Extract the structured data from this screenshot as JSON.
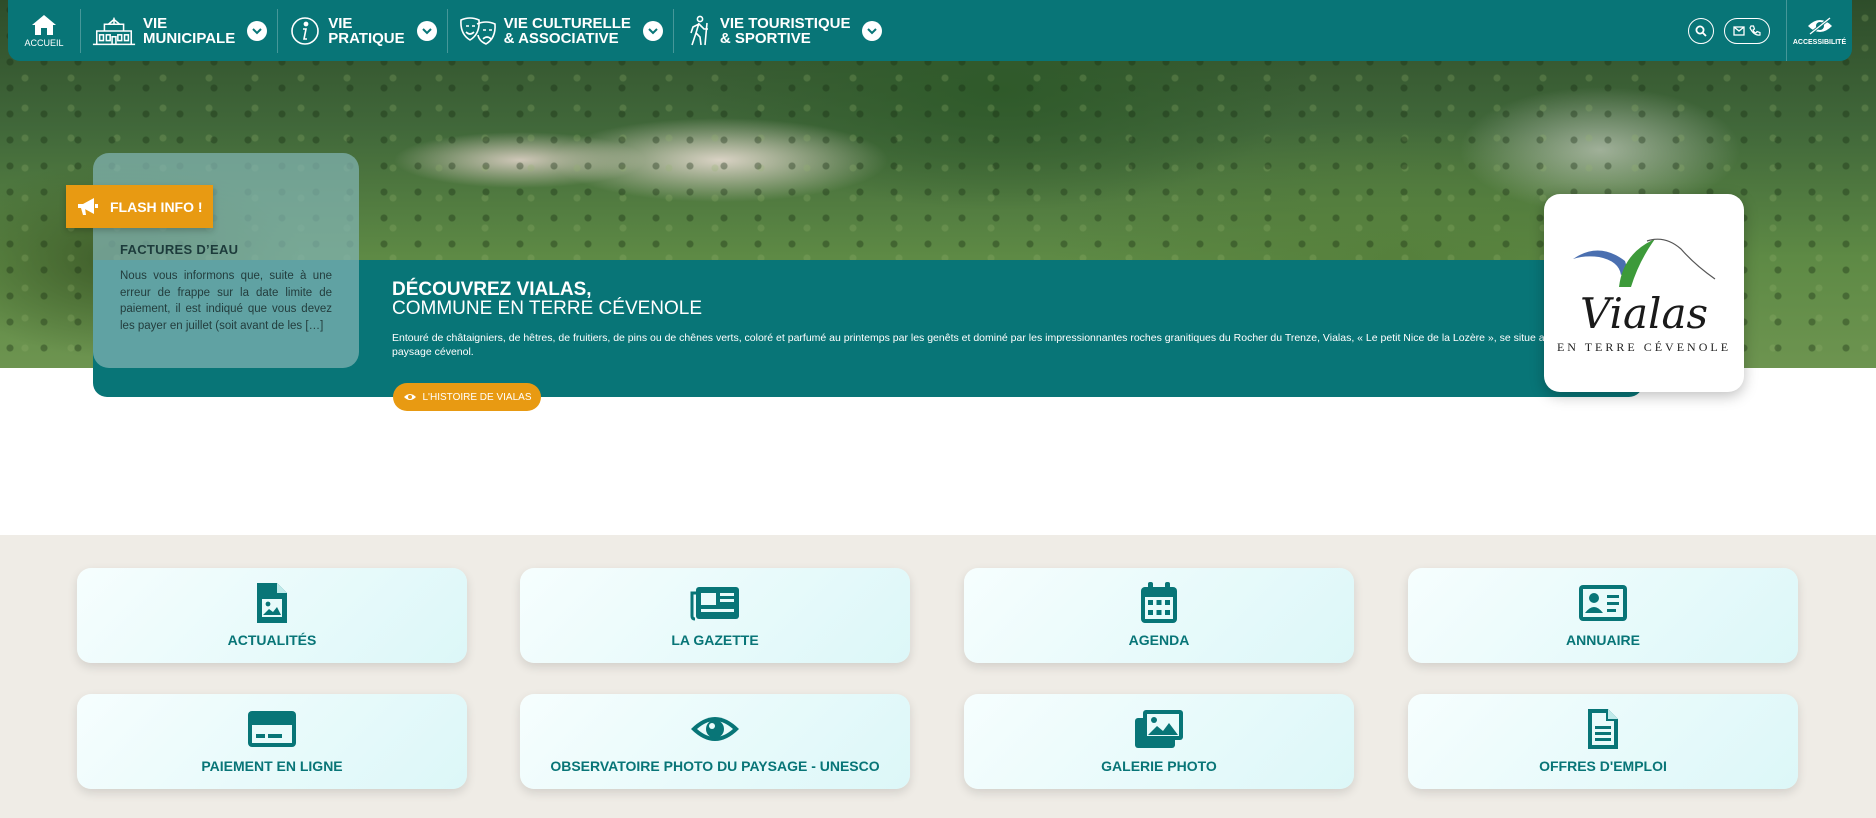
{
  "colors": {
    "primary": "#087577",
    "accent": "#e89a12",
    "quick_bg": "#efece6"
  },
  "nav": {
    "home_label": "ACCUEIL",
    "items": [
      {
        "label": "VIE\nMUNICIPALE",
        "icon": "town-hall-icon"
      },
      {
        "label": "VIE\nPRATIQUE",
        "icon": "info-icon"
      },
      {
        "label": "VIE CULTURELLE\n& ASSOCIATIVE",
        "icon": "theater-masks-icon"
      },
      {
        "label": "VIE TOURISTIQUE\n& SPORTIVE",
        "icon": "hiker-icon"
      }
    ],
    "accessibility_label": "ACCESSIBILITÉ"
  },
  "flash": {
    "tag": "FLASH INFO !",
    "title": "FACTURES D’EAU",
    "text": "Nous vous informons que, suite à une erreur de frappe sur la date limite de paiement, il est indiqué que vous devez les payer en juillet (soit avant de les […]"
  },
  "discover": {
    "title_line1": "DÉCOUVREZ VIALAS,",
    "title_line2": "COMMUNE EN TERRE CÉVENOLE",
    "description": "Entouré de châtaigniers, de hêtres, de fruitiers, de pins ou de chênes verts, coloré et parfumé au printemps par les genêts et dominé par les impressionnantes roches granitiques du Rocher du Trenze, Vialas, « Le petit Nice de la Lozère », se situe au cœur de ce paysage cévenol.",
    "button": "L'HISTOIRE DE VIALAS"
  },
  "logo": {
    "word": "Vialas",
    "subtitle": "EN TERRE CÉVENOLE"
  },
  "quick_links": [
    {
      "label": "ACTUALITÉS",
      "icon": "news-image-icon"
    },
    {
      "label": "LA GAZETTE",
      "icon": "newspaper-icon"
    },
    {
      "label": "AGENDA",
      "icon": "calendar-icon"
    },
    {
      "label": "ANNUAIRE",
      "icon": "contact-card-icon"
    },
    {
      "label": "PAIEMENT EN LIGNE",
      "icon": "credit-card-icon"
    },
    {
      "label": "OBSERVATOIRE PHOTO DU PAYSAGE - UNESCO",
      "icon": "eye-icon"
    },
    {
      "label": "GALERIE PHOTO",
      "icon": "photo-gallery-icon"
    },
    {
      "label": "OFFRES D'EMPLOI",
      "icon": "document-icon"
    }
  ]
}
